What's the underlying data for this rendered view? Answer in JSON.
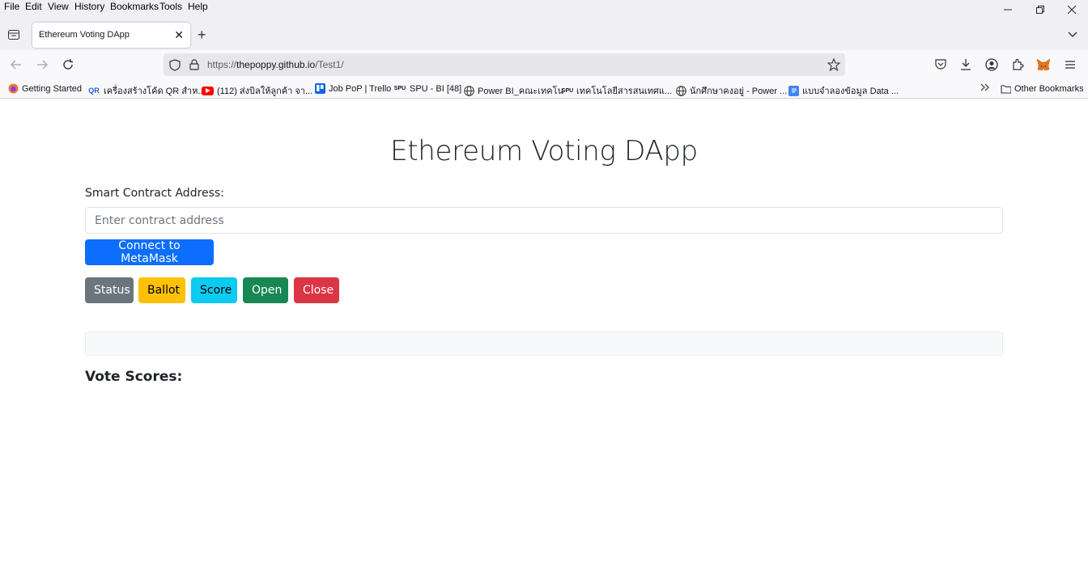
{
  "menubar": {
    "items": [
      "File",
      "Edit",
      "View",
      "History",
      "Bookmarks",
      "Tools",
      "Help"
    ]
  },
  "tab": {
    "title": "Ethereum Voting DApp"
  },
  "urlbar": {
    "scheme": "https://",
    "host": "thepoppy.github.io",
    "path": "/Test1/"
  },
  "bookmarks": {
    "items": [
      {
        "label": "Getting Started",
        "icon": "firefox-icon"
      },
      {
        "label": "เครื่องสร้างโค้ด QR สำห...",
        "icon": "qr-icon"
      },
      {
        "label": "(112) ส่งบิลให้ลูกค้า จา...",
        "icon": "youtube-icon"
      },
      {
        "label": "Job PoP | Trello",
        "icon": "trello-icon"
      },
      {
        "label": "SPU - BI [48]",
        "icon": "spu-icon"
      },
      {
        "label": "Power BI_คณะเทคโน",
        "icon": "globe-icon"
      },
      {
        "label": "เทคโนโลยีสารสนเทศแ...",
        "icon": "spu-icon"
      },
      {
        "label": "นักศึกษาคงอยู่ - Power ...",
        "icon": "globe-icon"
      },
      {
        "label": "แบบจำลองข้อมูล Data ...",
        "icon": "docs-icon"
      }
    ],
    "other_label": "Other Bookmarks"
  },
  "app": {
    "title": "Ethereum Voting DApp",
    "address_label": "Smart Contract Address:",
    "address_placeholder": "Enter contract address",
    "address_value": "",
    "connect_label": "Connect to MetaMask",
    "buttons": {
      "status": "Status",
      "ballot": "Ballot",
      "score": "Score",
      "open": "Open",
      "close": "Close"
    },
    "status_text": "",
    "scores_heading": "Vote Scores:"
  },
  "colors": {
    "primary": "#0d6efd",
    "secondary": "#6c757d",
    "warning": "#ffc107",
    "info": "#0dcaf0",
    "success": "#198754",
    "danger": "#dc3545"
  }
}
